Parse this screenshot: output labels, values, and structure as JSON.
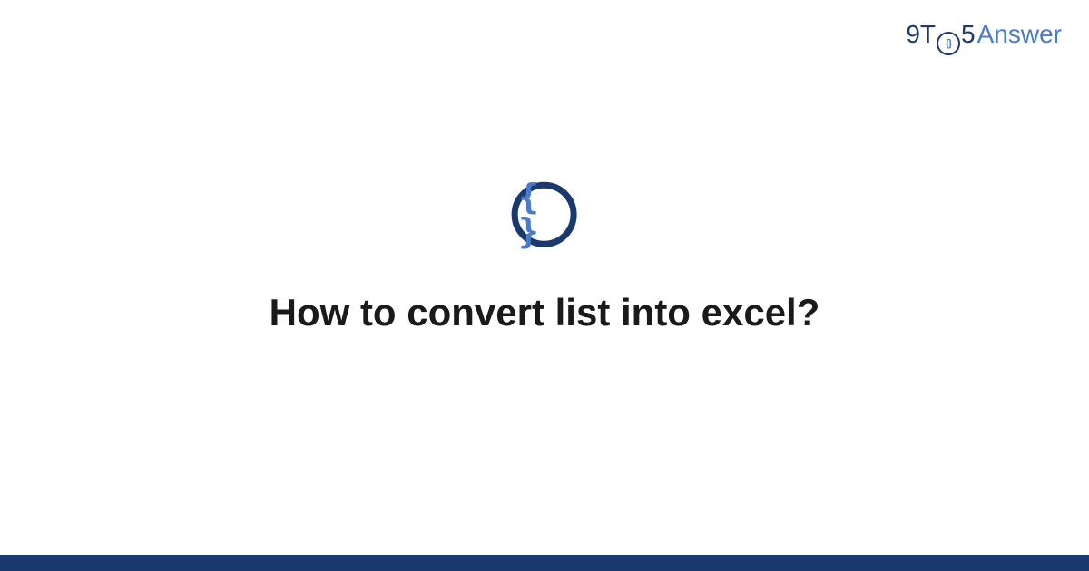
{
  "logo": {
    "part_9t": "9T",
    "part_o_inner": "{}",
    "part_5": "5",
    "part_answer": "Answer"
  },
  "center_icon": {
    "glyph": "{ }"
  },
  "question": {
    "title": "How to convert list into excel?"
  }
}
